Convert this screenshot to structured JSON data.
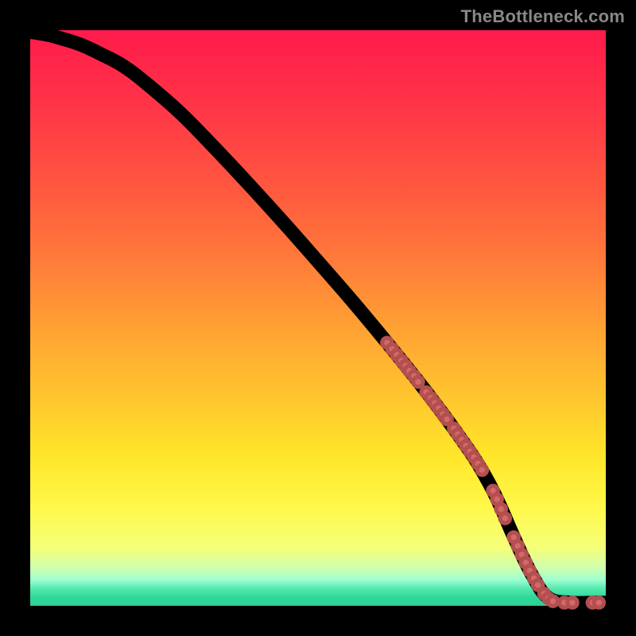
{
  "watermark": "TheBottleneck.com",
  "colors": {
    "marker_fill": "#d26a6a",
    "marker_stroke": "#b44f4f",
    "curve": "#000000",
    "frame": "#000000"
  },
  "gradient_stops": [
    {
      "offset": 0.0,
      "color": "#ff1a4b"
    },
    {
      "offset": 0.14,
      "color": "#ff3747"
    },
    {
      "offset": 0.28,
      "color": "#ff593f"
    },
    {
      "offset": 0.4,
      "color": "#ff7b3a"
    },
    {
      "offset": 0.52,
      "color": "#ffa233"
    },
    {
      "offset": 0.64,
      "color": "#ffc62e"
    },
    {
      "offset": 0.74,
      "color": "#ffe62a"
    },
    {
      "offset": 0.83,
      "color": "#fff84a"
    },
    {
      "offset": 0.9,
      "color": "#f4ff7a"
    },
    {
      "offset": 0.935,
      "color": "#ceffb0"
    },
    {
      "offset": 0.955,
      "color": "#9dffcf"
    },
    {
      "offset": 0.97,
      "color": "#55e9b0"
    },
    {
      "offset": 0.985,
      "color": "#30d89a"
    },
    {
      "offset": 1.0,
      "color": "#2cd095"
    }
  ],
  "chart_data": {
    "type": "line",
    "title": "",
    "xlabel": "",
    "ylabel": "",
    "x_range": [
      0,
      100
    ],
    "y_range": [
      0,
      100
    ],
    "curve": {
      "x": [
        0,
        3,
        6,
        9,
        12,
        16,
        20,
        26,
        32,
        38,
        44,
        50,
        56,
        62,
        67,
        71,
        74,
        77,
        79,
        80.5,
        82,
        84,
        87,
        90,
        94,
        98,
        100
      ],
      "y": [
        99.7,
        99.2,
        98.4,
        97.4,
        96.0,
        93.9,
        90.9,
        85.7,
        79.6,
        73.2,
        66.6,
        59.8,
        52.9,
        45.7,
        39.5,
        34.3,
        30.2,
        25.9,
        22.6,
        19.8,
        16.6,
        12.0,
        5.7,
        1.4,
        0.55,
        0.55,
        0.55
      ],
      "note": "y values are estimated % heights from the plot; x is normalized 0-100 horizontal position"
    },
    "markers": {
      "x": [
        62.0,
        62.9,
        63.7,
        64.5,
        65.2,
        65.9,
        66.7,
        67.4,
        68.8,
        69.6,
        70.3,
        71.0,
        71.7,
        72.4,
        73.6,
        74.3,
        75.0,
        75.7,
        76.4,
        77.1,
        77.8,
        78.5,
        80.4,
        81.1,
        81.8,
        82.5,
        84.0,
        84.7,
        85.4,
        86.1,
        86.8,
        87.5,
        88.2,
        89.3,
        90.0,
        90.8,
        92.8,
        94.2,
        97.7,
        98.8
      ],
      "y": [
        45.7,
        44.6,
        43.6,
        42.6,
        41.7,
        40.8,
        39.9,
        38.9,
        37.1,
        36.1,
        35.2,
        34.3,
        33.3,
        32.4,
        30.8,
        29.8,
        28.8,
        27.8,
        26.8,
        25.8,
        24.7,
        23.6,
        20.0,
        18.5,
        16.8,
        15.2,
        11.9,
        10.4,
        8.9,
        7.5,
        6.1,
        4.8,
        3.6,
        2.1,
        1.3,
        0.8,
        0.55,
        0.55,
        0.55,
        0.55
      ],
      "radius": 6.2
    },
    "grid": false,
    "legend": null
  }
}
